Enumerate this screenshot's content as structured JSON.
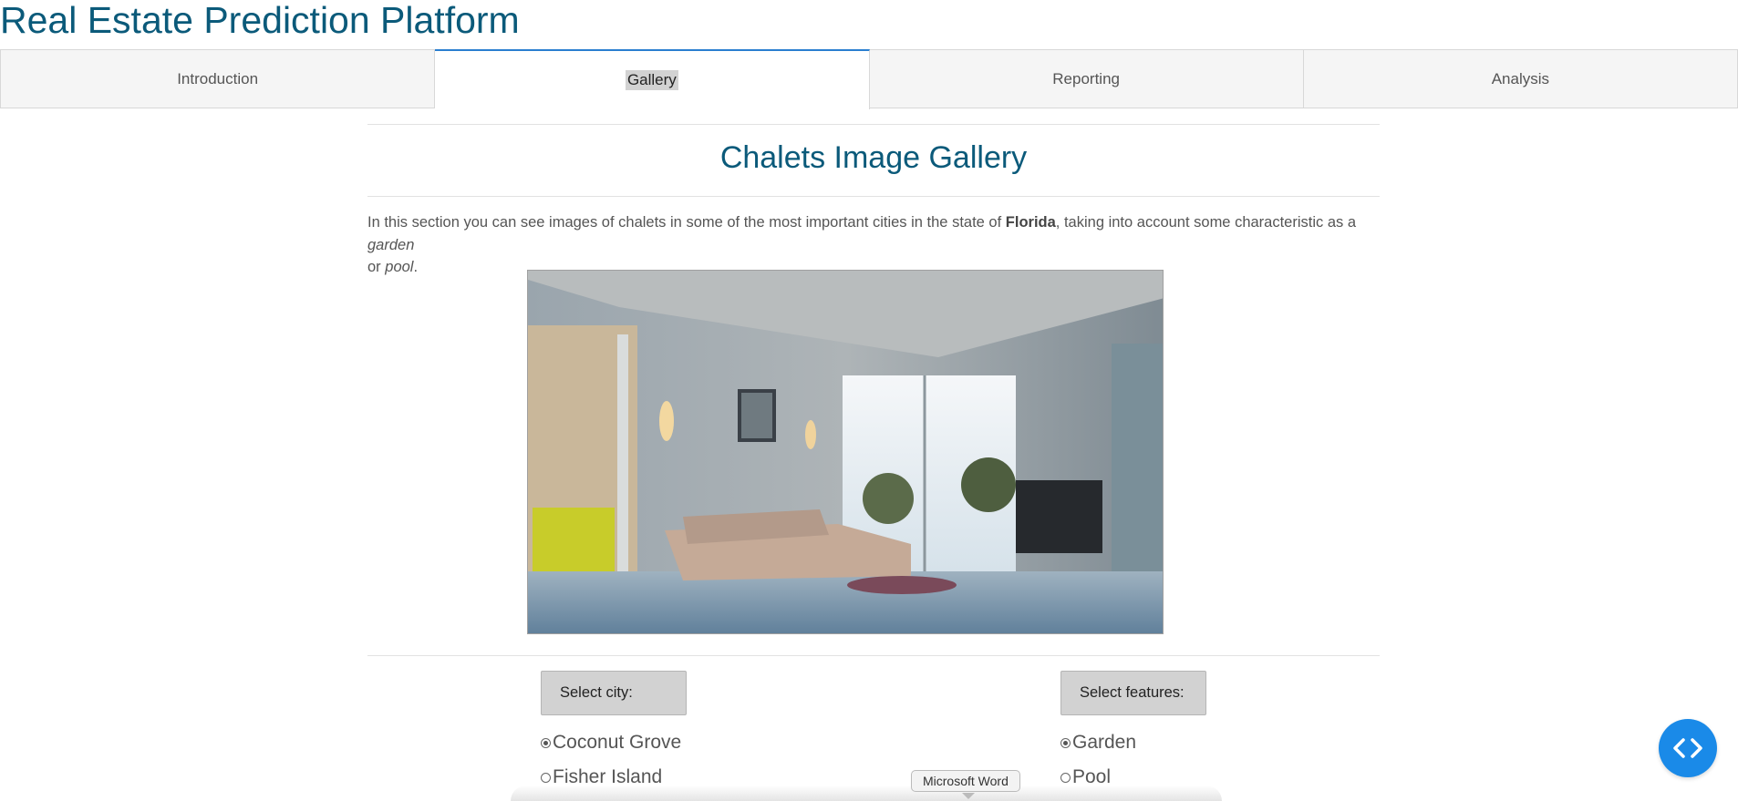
{
  "header": {
    "title": "Real Estate Prediction Platform"
  },
  "tabs": [
    {
      "label": "Introduction"
    },
    {
      "label": "Gallery",
      "active": true
    },
    {
      "label": "Reporting"
    },
    {
      "label": "Analysis"
    }
  ],
  "gallery": {
    "title": "Chalets Image Gallery",
    "desc_part1": "In this section you can see images of chalets in some of the most important cities in the state of ",
    "desc_bold": "Florida",
    "desc_part2": ", taking into account some characteristic as a ",
    "desc_em1": "garden",
    "desc_part3": " or ",
    "desc_em2": "pool",
    "desc_part4": "."
  },
  "city_select": {
    "label": "Select city:",
    "options": [
      {
        "label": "Coconut Grove",
        "checked": true
      },
      {
        "label": "Fisher Island",
        "checked": false
      }
    ]
  },
  "feature_select": {
    "label": "Select features:",
    "options": [
      {
        "label": "Garden",
        "checked": true
      },
      {
        "label": "Pool",
        "checked": false
      }
    ]
  },
  "tooltip": {
    "text": "Microsoft Word"
  },
  "colors": {
    "title": "#0b5a7a",
    "fab": "#1a8ae8",
    "active_tab_border": "#2a7fd0"
  },
  "icons": {
    "fab": "code-icon"
  }
}
